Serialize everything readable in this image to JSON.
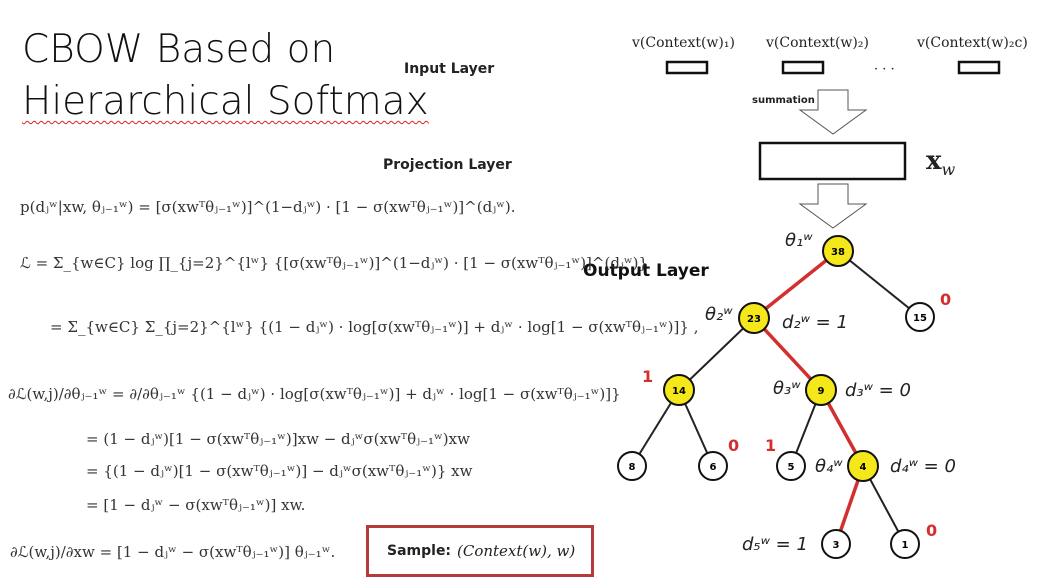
{
  "title_line1": "CBOW Based on",
  "title_line2": "Hierarchical Softmax",
  "layers": {
    "input": "Input Layer",
    "projection": "Projection Layer",
    "output": "Output Layer"
  },
  "context_labels": [
    "v(Context(w)₁)",
    "v(Context(w)₂)",
    "v(Context(w)₂c)"
  ],
  "ellipsis": "· · ·",
  "summation": "summation",
  "xw": "xw",
  "equations": {
    "e1": "p(dⱼʷ|xw, θⱼ₋₁ʷ) = [σ(xwᵀθⱼ₋₁ʷ)]^(1−dⱼʷ) · [1 − σ(xwᵀθⱼ₋₁ʷ)]^(dⱼʷ).",
    "e2": "ℒ  =  Σ_{w∈C} log ∏_{j=2}^{lʷ} {[σ(xwᵀθⱼ₋₁ʷ)]^(1−dⱼʷ) · [1 − σ(xwᵀθⱼ₋₁ʷ)]^(dⱼʷ)}",
    "e3": "=  Σ_{w∈C} Σ_{j=2}^{lʷ} {(1 − dⱼʷ) · log[σ(xwᵀθⱼ₋₁ʷ)] + dⱼʷ · log[1 − σ(xwᵀθⱼ₋₁ʷ)]} ,",
    "e4": "∂ℒ(w,j)/∂θⱼ₋₁ʷ  =  ∂/∂θⱼ₋₁ʷ {(1 − dⱼʷ) · log[σ(xwᵀθⱼ₋₁ʷ)] + dⱼʷ · log[1 − σ(xwᵀθⱼ₋₁ʷ)]}",
    "e5": "=  (1 − dⱼʷ)[1 − σ(xwᵀθⱼ₋₁ʷ)]xw − dⱼʷσ(xwᵀθⱼ₋₁ʷ)xw",
    "e6": "=  {(1 − dⱼʷ)[1 − σ(xwᵀθⱼ₋₁ʷ)] − dⱼʷσ(xwᵀθⱼ₋₁ʷ)} xw",
    "e7": "=  [1 − dⱼʷ − σ(xwᵀθⱼ₋₁ʷ)] xw.",
    "e8": "∂ℒ(w,j)/∂xw = [1 − dⱼʷ − σ(xwᵀθⱼ₋₁ʷ)] θⱼ₋₁ʷ."
  },
  "sample": {
    "label": "Sample:",
    "value": "(Context(w), w)"
  },
  "tree": {
    "nodes": [
      "38",
      "23",
      "15",
      "14",
      "9",
      "8",
      "6",
      "5",
      "4",
      "3",
      "1"
    ],
    "edge_labels": [
      "0",
      "1",
      "0",
      "1",
      "0"
    ],
    "annotations": {
      "theta1": "θ₁ʷ",
      "theta2": "θ₂ʷ",
      "theta3": "θ₃ʷ",
      "theta4": "θ₄ʷ",
      "d2": "d₂ʷ = 1",
      "d3": "d₃ʷ = 0",
      "d4": "d₄ʷ = 0",
      "d5": "d₅ʷ = 1"
    }
  },
  "colors": {
    "highlight_node": "#f4e81b",
    "path_edge": "#d32f2f",
    "edge_label": "#d32f2f",
    "sample_border": "#b53b3b"
  }
}
